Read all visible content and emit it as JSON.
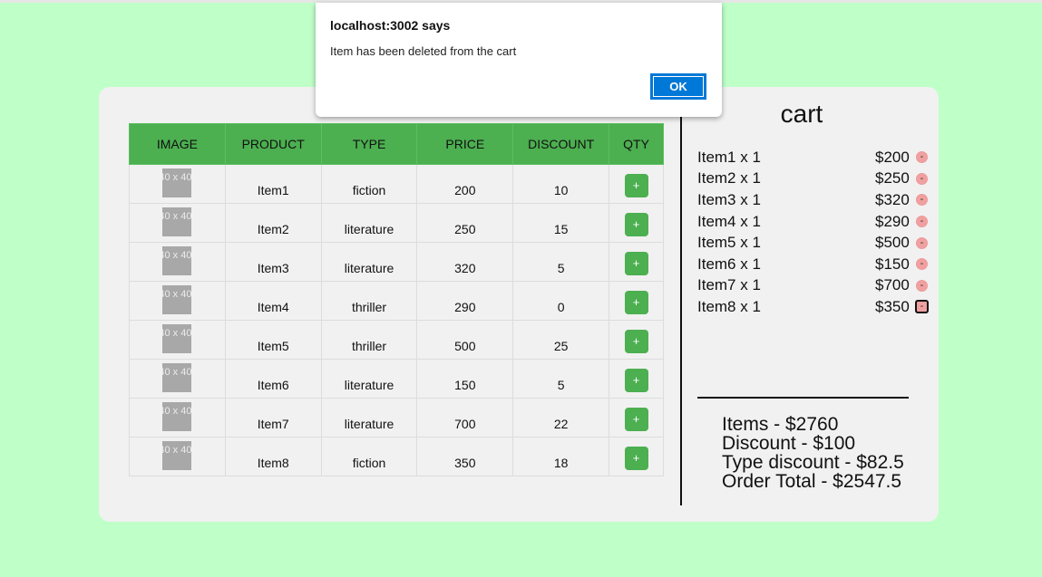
{
  "dialog": {
    "title": "localhost:3002 says",
    "message": "Item has been deleted from the cart",
    "ok_label": "OK"
  },
  "table": {
    "headers": [
      "IMAGE",
      "PRODUCT",
      "TYPE",
      "PRICE",
      "DISCOUNT",
      "QTY"
    ],
    "image_placeholder": "40 x 40",
    "add_label": "+",
    "rows": [
      {
        "product": "Item1",
        "type": "fiction",
        "price": "200",
        "discount": "10"
      },
      {
        "product": "Item2",
        "type": "literature",
        "price": "250",
        "discount": "15"
      },
      {
        "product": "Item3",
        "type": "literature",
        "price": "320",
        "discount": "5"
      },
      {
        "product": "Item4",
        "type": "thriller",
        "price": "290",
        "discount": "0"
      },
      {
        "product": "Item5",
        "type": "thriller",
        "price": "500",
        "discount": "25"
      },
      {
        "product": "Item6",
        "type": "literature",
        "price": "150",
        "discount": "5"
      },
      {
        "product": "Item7",
        "type": "literature",
        "price": "700",
        "discount": "22"
      },
      {
        "product": "Item8",
        "type": "fiction",
        "price": "350",
        "discount": "18"
      }
    ]
  },
  "cart": {
    "title": "cart",
    "remove_label": "-",
    "items": [
      {
        "label": "Item1 x 1",
        "price": "$200"
      },
      {
        "label": "Item2 x 1",
        "price": "$250"
      },
      {
        "label": "Item3 x 1",
        "price": "$320"
      },
      {
        "label": "Item4 x 1",
        "price": "$290"
      },
      {
        "label": "Item5 x 1",
        "price": "$500"
      },
      {
        "label": "Item6 x 1",
        "price": "$150"
      },
      {
        "label": "Item7 x 1",
        "price": "$700"
      },
      {
        "label": "Item8 x 1",
        "price": "$350"
      }
    ],
    "summary": {
      "items": "Items - $2760",
      "discount": "Discount - $100",
      "type_discount": "Type discount - $82.5",
      "order_total": "Order Total - $2547.5"
    }
  },
  "colors": {
    "page_background": "#bfffc8",
    "header_green": "#4caf50",
    "dialog_button": "#0078d7",
    "remove_button": "#f0a0a0"
  }
}
